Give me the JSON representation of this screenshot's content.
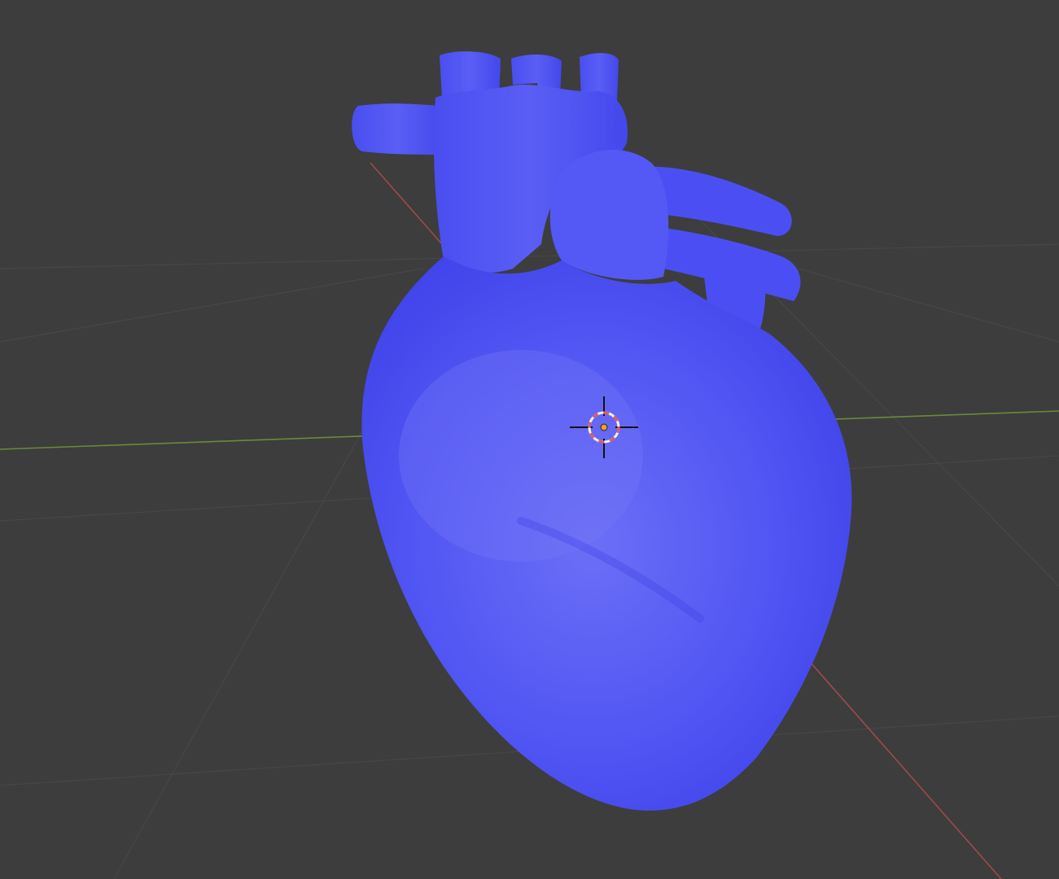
{
  "viewport": {
    "background_color": "#3d3d3d",
    "grid_color": "#474747",
    "x_axis_color": "#a04949",
    "y_axis_color": "#6a8a3a"
  },
  "object": {
    "type": "heart-mesh",
    "color": "#4b4ff3"
  },
  "cursor": {
    "icon": "3d-cursor-icon",
    "ring_color_a": "#e35a5a",
    "ring_color_b": "#f2f2f2",
    "origin_color": "#f0a020"
  }
}
